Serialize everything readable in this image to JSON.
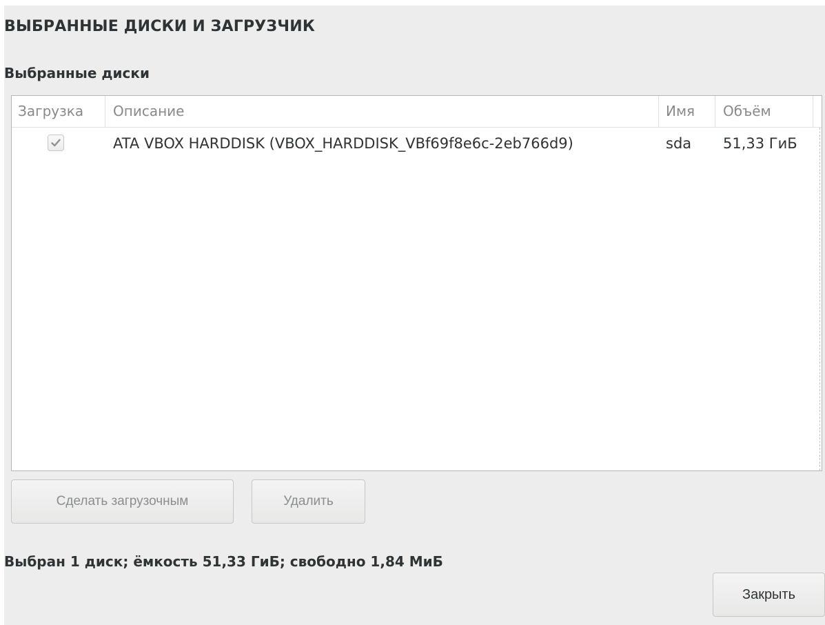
{
  "dialog": {
    "title": "ВЫБРАННЫЕ ДИСКИ И ЗАГРУЗЧИК",
    "section_label": "Выбранные диски"
  },
  "table": {
    "columns": {
      "boot": "Загрузка",
      "description": "Описание",
      "name": "Имя",
      "size": "Объём"
    },
    "rows": [
      {
        "boot_checked": true,
        "description": "ATA VBOX HARDDISK (VBOX_HARDDISK_VBf69f8e6c-2eb766d9)",
        "name": "sda",
        "size": "51,33 ГиБ"
      }
    ]
  },
  "buttons": {
    "set_boot": "Сделать загрузочным",
    "remove": "Удалить",
    "close": "Закрыть"
  },
  "summary": "Выбран 1 диск; ёмкость 51,33 ГиБ; свободно 1,84 МиБ",
  "icons": {
    "checkmark": "checkmark-icon"
  },
  "colors": {
    "background": "#ededed",
    "table_background": "#ffffff",
    "text": "#2e3436",
    "muted_text": "#888a85"
  }
}
